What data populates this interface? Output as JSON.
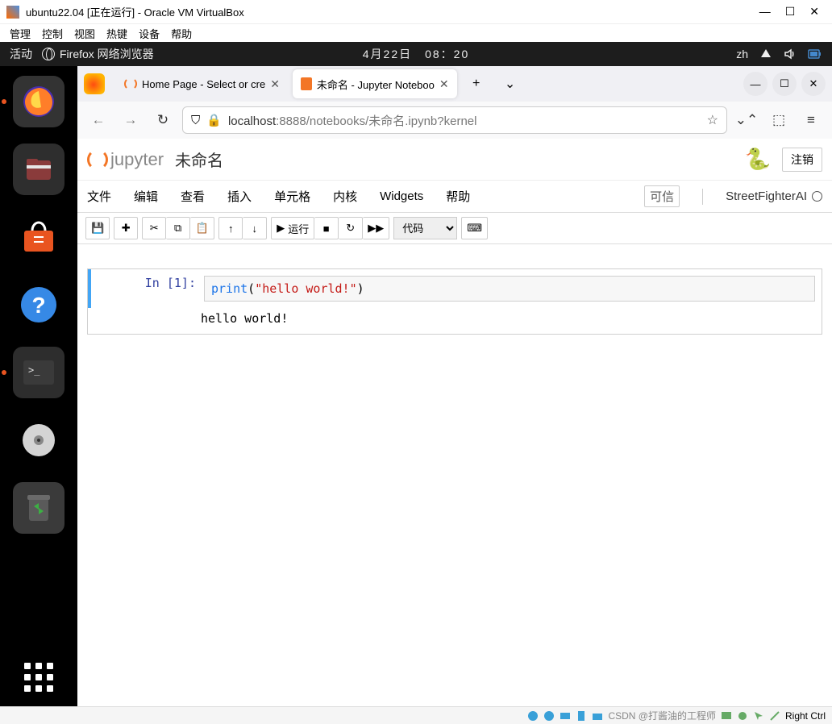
{
  "virtualbox": {
    "title": "ubuntu22.04 [正在运行] - Oracle VM VirtualBox",
    "menu": [
      "管理",
      "控制",
      "视图",
      "热键",
      "设备",
      "帮助"
    ],
    "status_text": "Right Ctrl",
    "watermark": "CSDN @打酱油的工程师"
  },
  "ubuntu": {
    "activities": "活动",
    "app_name": "Firefox 网络浏览器",
    "time": "4月22日　08：20",
    "lang": "zh"
  },
  "browser": {
    "tabs": [
      {
        "title": "Home Page - Select or cre"
      },
      {
        "title": "未命名 - Jupyter Noteboo"
      }
    ],
    "url_host": "localhost",
    "url_path": ":8888/notebooks/未命名.ipynb?kernel"
  },
  "jupyter": {
    "brand": "jupyter",
    "notebook_title": "未命名",
    "logout": "注销",
    "menus": [
      "文件",
      "编辑",
      "查看",
      "插入",
      "单元格",
      "内核",
      "Widgets",
      "帮助"
    ],
    "trust": "可信",
    "kernel": "StreetFighterAI",
    "run_label": "运行",
    "select_type": "代码",
    "cell_prompt": "In [1]:",
    "code_fn": "print",
    "code_str": "\"hello world!\"",
    "output": "hello world!"
  }
}
